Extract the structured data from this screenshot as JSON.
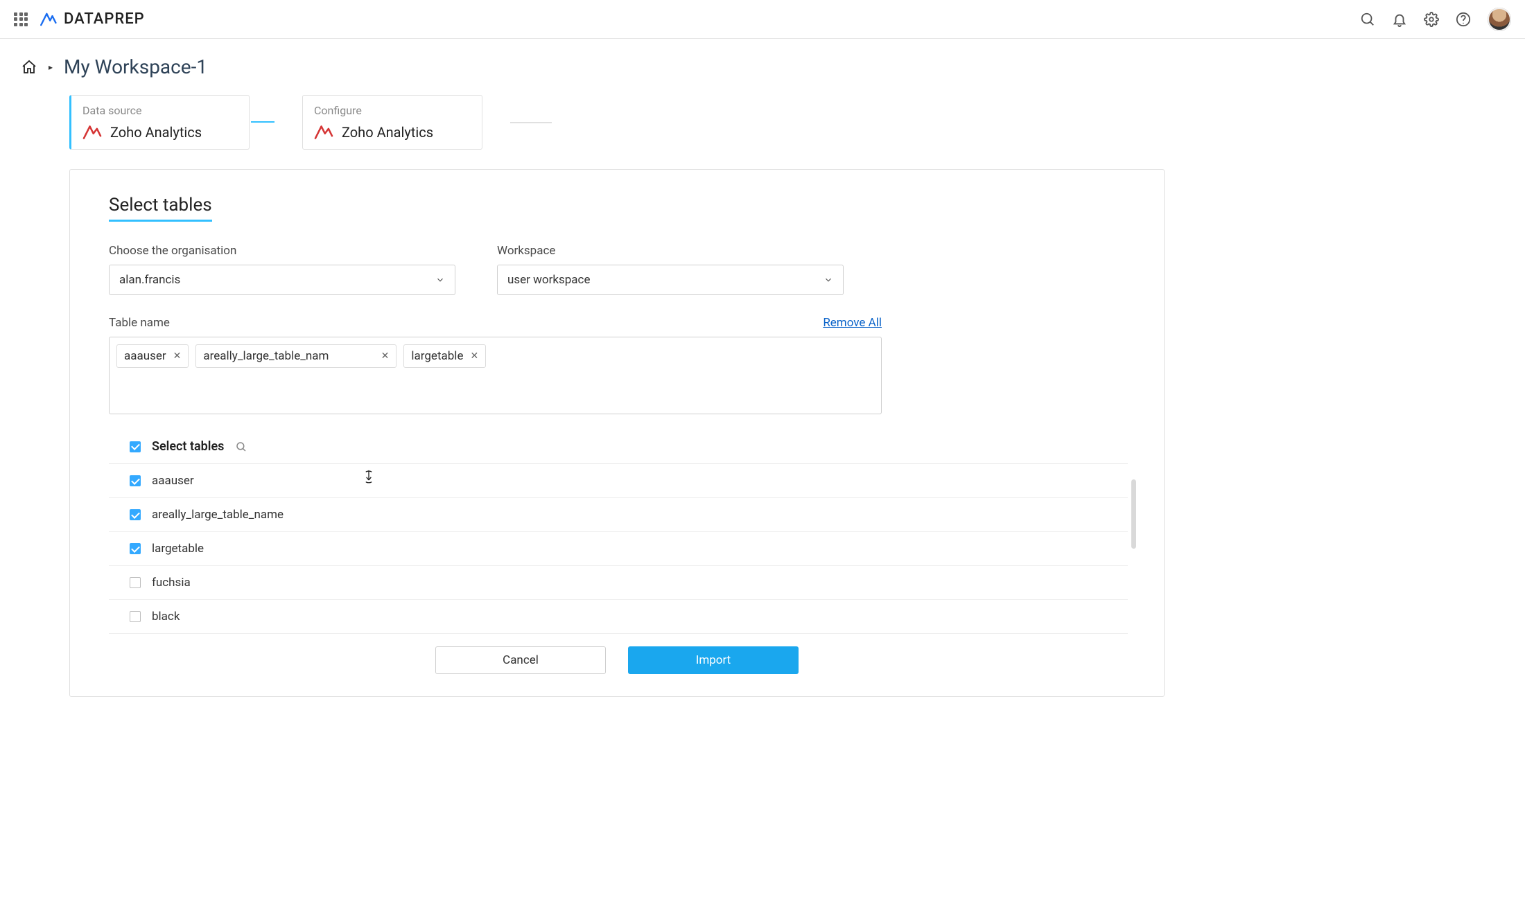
{
  "header": {
    "app_name": "DATAPREP"
  },
  "breadcrumb": {
    "title": "My Workspace-1"
  },
  "steps": [
    {
      "label": "Data source",
      "source": "Zoho Analytics",
      "active": true
    },
    {
      "label": "Configure",
      "source": "Zoho Analytics",
      "active": false
    }
  ],
  "panel": {
    "title": "Select tables",
    "org": {
      "label": "Choose the organisation",
      "value": "alan.francis"
    },
    "workspace": {
      "label": "Workspace",
      "value": "user workspace"
    },
    "tableName": {
      "label": "Table name",
      "remove_all": "Remove All",
      "tags": [
        "aaauser",
        "areally_large_table_nam",
        "largetable"
      ]
    },
    "tableList": {
      "heading": "Select tables",
      "rows": [
        {
          "name": "aaauser",
          "checked": true
        },
        {
          "name": "areally_large_table_name",
          "checked": true
        },
        {
          "name": "largetable",
          "checked": true
        },
        {
          "name": "fuchsia",
          "checked": false
        },
        {
          "name": "black",
          "checked": false
        }
      ]
    },
    "buttons": {
      "cancel": "Cancel",
      "import": "Import"
    }
  }
}
